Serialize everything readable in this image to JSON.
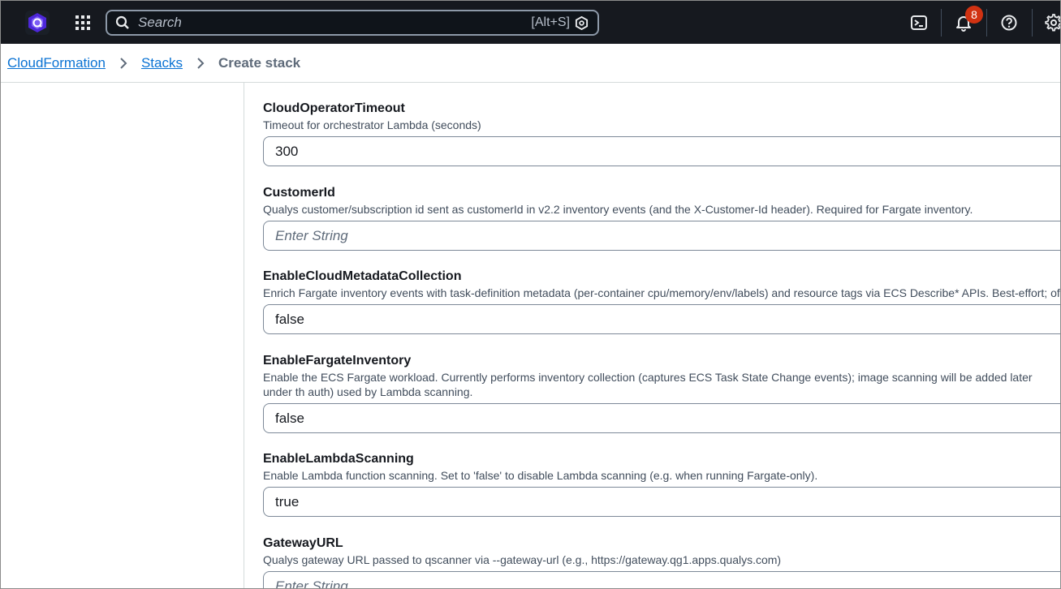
{
  "topbar": {
    "search_placeholder": "Search",
    "search_shortcut": "[Alt+S]",
    "notification_count": "8"
  },
  "breadcrumb": {
    "items": [
      "CloudFormation",
      "Stacks"
    ],
    "current": "Create stack"
  },
  "parameters": [
    {
      "label": "CloudOperatorTimeout",
      "description": "Timeout for orchestrator Lambda (seconds)",
      "value": "300",
      "placeholder": ""
    },
    {
      "label": "CustomerId",
      "description": "Qualys customer/subscription id sent as customerId in v2.2 inventory events (and the X-Customer-Id header). Required for Fargate inventory.",
      "value": "",
      "placeholder": "Enter String"
    },
    {
      "label": "EnableCloudMetadataCollection",
      "description": "Enrich Fargate inventory events with task-definition metadata (per-container cpu/memory/env/labels) and resource tags via ECS Describe* APIs. Best-effort; of",
      "value": "false",
      "placeholder": ""
    },
    {
      "label": "EnableFargateInventory",
      "description": "Enable the ECS Fargate workload. Currently performs inventory collection (captures ECS Task State Change events); image scanning will be added later under th auth) used by Lambda scanning.",
      "value": "false",
      "placeholder": ""
    },
    {
      "label": "EnableLambdaScanning",
      "description": "Enable Lambda function scanning. Set to 'false' to disable Lambda scanning (e.g. when running Fargate-only).",
      "value": "true",
      "placeholder": ""
    },
    {
      "label": "GatewayURL",
      "description": "Qualys gateway URL passed to qscanner via --gateway-url (e.g., https://gateway.qg1.apps.qualys.com)",
      "value": "",
      "placeholder": "Enter String"
    }
  ]
}
